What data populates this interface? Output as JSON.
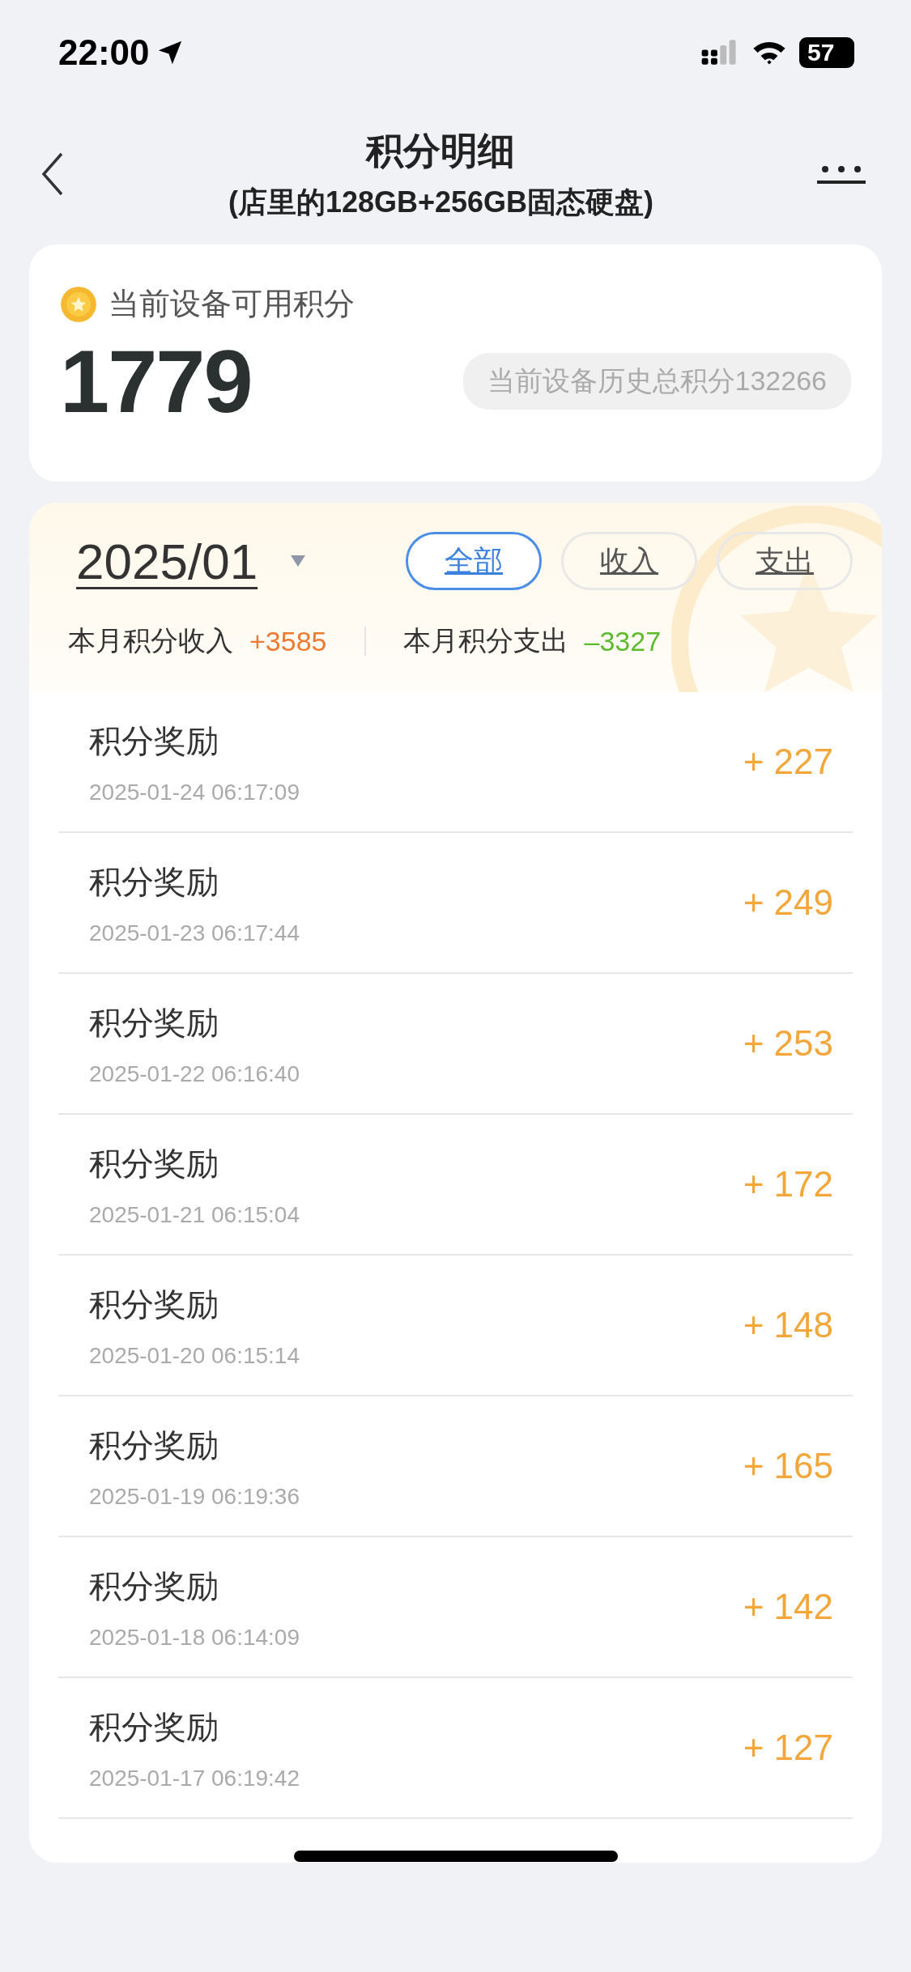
{
  "status_bar": {
    "time": "22:00",
    "battery": "57"
  },
  "nav": {
    "title": "积分明细",
    "subtitle": "(店里的128GB+256GB固态硬盘)"
  },
  "points_card": {
    "label": "当前设备可用积分",
    "value": "1779",
    "history": "当前设备历史总积分132266"
  },
  "month": "2025/01",
  "filters": [
    {
      "label": "全部",
      "selected": true
    },
    {
      "label": "收入",
      "selected": false
    },
    {
      "label": "支出",
      "selected": false
    }
  ],
  "summary": [
    {
      "label": "本月积分收入",
      "value": "+3585",
      "kind": "income"
    },
    {
      "label": "本月积分支出",
      "value": "–3327",
      "kind": "expense"
    }
  ],
  "records": [
    {
      "title": "积分奖励",
      "time": "2025-01-24 06:17:09",
      "amount": "+ 227"
    },
    {
      "title": "积分奖励",
      "time": "2025-01-23 06:17:44",
      "amount": "+ 249"
    },
    {
      "title": "积分奖励",
      "time": "2025-01-22 06:16:40",
      "amount": "+ 253"
    },
    {
      "title": "积分奖励",
      "time": "2025-01-21 06:15:04",
      "amount": "+ 172"
    },
    {
      "title": "积分奖励",
      "time": "2025-01-20 06:15:14",
      "amount": "+ 148"
    },
    {
      "title": "积分奖励",
      "time": "2025-01-19 06:19:36",
      "amount": "+ 165"
    },
    {
      "title": "积分奖励",
      "time": "2025-01-18 06:14:09",
      "amount": "+ 142"
    },
    {
      "title": "积分奖励",
      "time": "2025-01-17 06:19:42",
      "amount": "+ 127"
    }
  ]
}
